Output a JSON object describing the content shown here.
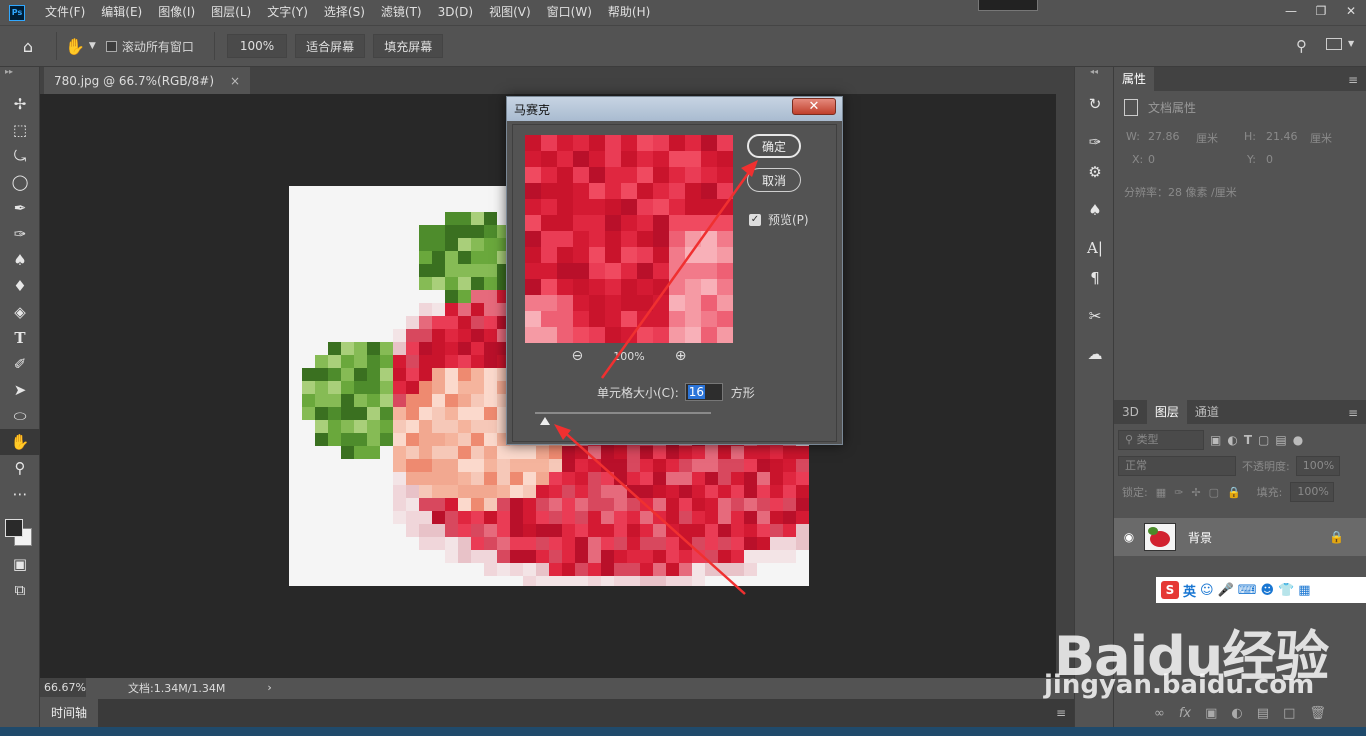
{
  "menubar": {
    "app_icon": "Ps",
    "items": [
      "文件(F)",
      "编辑(E)",
      "图像(I)",
      "图层(L)",
      "文字(Y)",
      "选择(S)",
      "滤镜(T)",
      "3D(D)",
      "视图(V)",
      "窗口(W)",
      "帮助(H)"
    ]
  },
  "options": {
    "scroll_all_label": "滚动所有窗口",
    "zoom_value": "100%",
    "fit_screen_label": "适合屏幕",
    "fill_screen_label": "填充屏幕"
  },
  "document": {
    "tab_title": "780.jpg @ 66.7%(RGB/8#)",
    "close_glyph": "×"
  },
  "status": {
    "zoom": "66.67%",
    "doc_size": "文档:1.34M/1.34M",
    "arrow": "›"
  },
  "timeline": {
    "tab_label": "时间轴"
  },
  "properties": {
    "tab_label": "属性",
    "doc_props_label": "文档属性",
    "w_label": "W:",
    "w_value": "27.86",
    "w_unit": "厘米",
    "h_label": "H:",
    "h_value": "21.46",
    "h_unit": "厘米",
    "x_label": "X:",
    "x_value": "0",
    "y_label": "Y:",
    "y_value": "0",
    "resolution": "分辨率：28 像素 /厘米"
  },
  "layers": {
    "tabs": [
      "3D",
      "图层",
      "通道"
    ],
    "active_tab": "图层",
    "filter_kind": "类型",
    "blend_mode": "正常",
    "opacity_label": "不透明度:",
    "opacity_value": "100%",
    "lock_label": "锁定:",
    "fill_label": "填充:",
    "fill_value": "100%",
    "layer_name": "背景"
  },
  "dialog": {
    "title": "马赛克",
    "close_glyph": "✕",
    "ok_label": "确定",
    "cancel_label": "取消",
    "preview_label": "预览(P)",
    "preview_checked": true,
    "zoom_level": "100%",
    "cell_size_label": "单元格大小(C):",
    "cell_size_value": "16",
    "cell_size_unit": "方形"
  },
  "ime": {
    "logo": "S",
    "lang": "英"
  },
  "watermark": {
    "brand": "Baidu经验",
    "url": "jingyan.baidu.com"
  },
  "colors": {
    "ui_bg": "#535353",
    "canvas_bg": "#282828",
    "accent_blue": "#2b74d8",
    "arrow_red": "#f03030"
  }
}
